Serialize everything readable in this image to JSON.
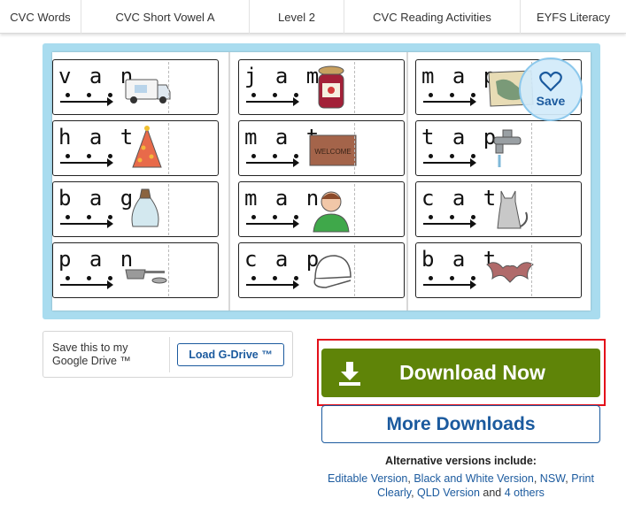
{
  "tags": [
    "CVC Words",
    "CVC Short Vowel A",
    "Level 2",
    "CVC Reading Activities",
    "EYFS Literacy"
  ],
  "cards": [
    {
      "word": "v a n",
      "image": "van-picture"
    },
    {
      "word": "j a m",
      "image": "jam-jar-picture"
    },
    {
      "word": "m a p",
      "image": "map-picture"
    },
    {
      "word": "h a t",
      "image": "party-hat-picture"
    },
    {
      "word": "m a t",
      "image": "welcome-mat-picture",
      "image_text": "WELCOME"
    },
    {
      "word": "t a p",
      "image": "tap-picture"
    },
    {
      "word": "b a g",
      "image": "bag-picture"
    },
    {
      "word": "m a n",
      "image": "man-picture"
    },
    {
      "word": "c a t",
      "image": "cat-picture"
    },
    {
      "word": "p a n",
      "image": "pan-picture"
    },
    {
      "word": "c a p",
      "image": "cap-picture"
    },
    {
      "word": "b a t",
      "image": "bat-picture"
    }
  ],
  "save_fab": {
    "label": "Save",
    "icon": "heart-icon"
  },
  "gdrive": {
    "text": "Save this to my Google Drive ™",
    "button": "Load G-Drive ™"
  },
  "download": {
    "label": "Download Now",
    "icon": "download-icon",
    "color": "#5f8408",
    "highlight_color": "#e3101a"
  },
  "more_downloads": {
    "label": "More Downloads"
  },
  "alternatives": {
    "title": "Alternative versions include:",
    "links": [
      "Editable Version",
      "Black and White Version",
      "NSW",
      "Print Clearly",
      "QLD Version",
      "4 others"
    ],
    "and_text": "and"
  },
  "colors": {
    "accent_blue": "#1b5a9e",
    "preview_bg": "#a9dcef"
  }
}
